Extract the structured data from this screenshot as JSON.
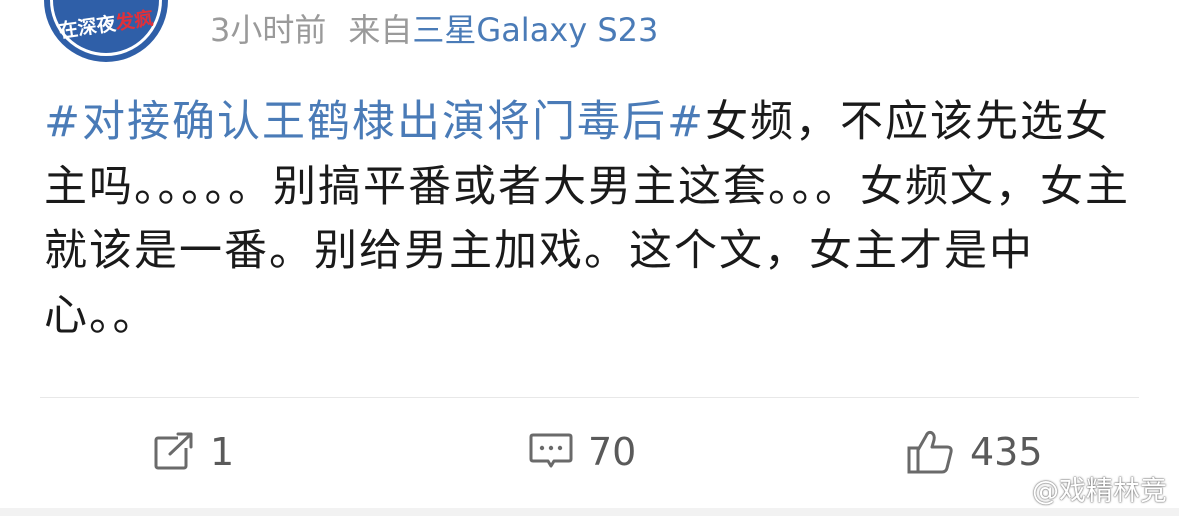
{
  "header": {
    "avatar_text_prefix": "在深夜",
    "avatar_text_highlight": "发疯",
    "time": "3小时前",
    "source_prefix": "来自",
    "device": "三星Galaxy S23"
  },
  "post": {
    "topic": "#对接确认王鹤棣出演将门毒后#",
    "body": "女频，不应该先选女主吗。。。。。别搞平番或者大男主这套。。。女频文，女主就该是一番。别给男主加戏。这个文，女主才是中心。。"
  },
  "actions": {
    "repost_count": "1",
    "comment_count": "70",
    "like_count": "435"
  },
  "watermark": {
    "text": "@戏精林竞"
  },
  "colors": {
    "link": "#4a7bb7",
    "meta": "#9a9a9a",
    "text": "#1a1a1a",
    "icon": "#6a6a6a"
  },
  "icons": {
    "repost": "repost-icon",
    "comment": "comment-icon",
    "like": "like-icon",
    "weibo": "weibo-logo-icon"
  }
}
